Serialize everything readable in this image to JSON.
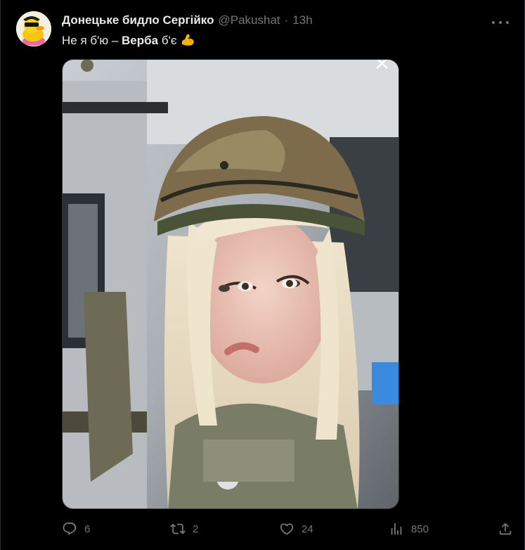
{
  "tweet": {
    "display_name": "Донецьке бидло Сергійко",
    "handle": "@Pakushat",
    "separator": "·",
    "time": "13h",
    "text_prefix": "Не я б'ю – ",
    "text_bold": "Верба",
    "text_suffix": " б'є",
    "emoji": "flexed-biceps-icon"
  },
  "actions": {
    "replies": "6",
    "reposts": "2",
    "likes": "24",
    "views": "850"
  },
  "colors": {
    "background": "#000000",
    "text_primary": "#e7e9ea",
    "text_secondary": "#71767b",
    "border": "#2f3336"
  }
}
